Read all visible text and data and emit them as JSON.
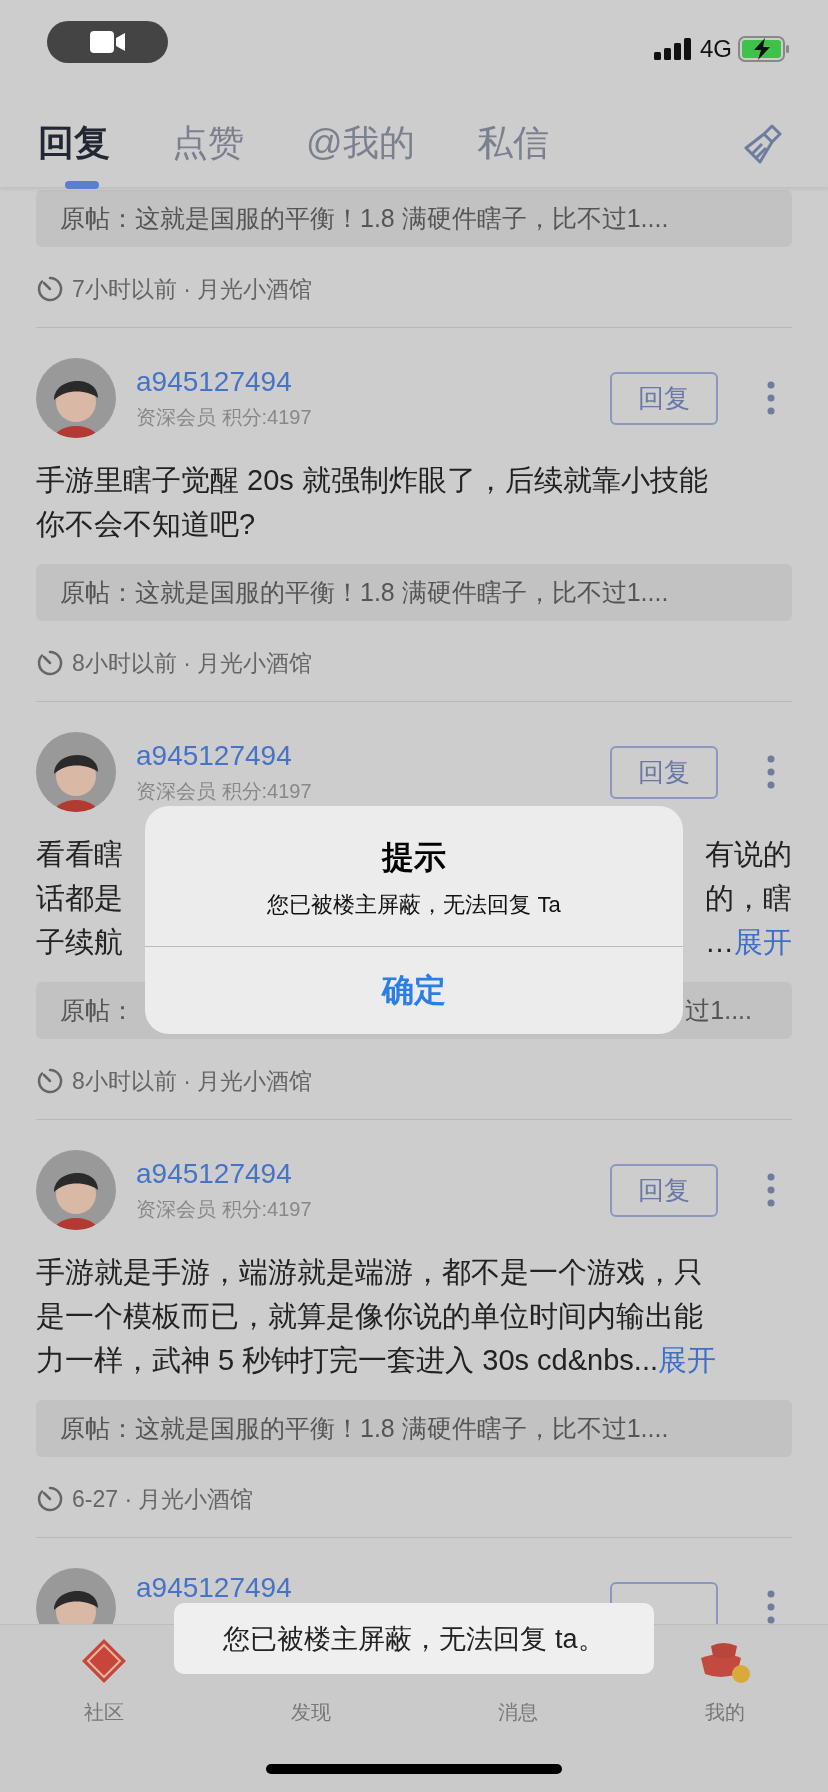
{
  "status_bar": {
    "network": "4G"
  },
  "tabs": [
    {
      "label": "回复",
      "selected": true
    },
    {
      "label": "点赞",
      "selected": false
    },
    {
      "label": "@我的",
      "selected": false
    },
    {
      "label": "私信",
      "selected": false
    }
  ],
  "posts": [
    {
      "kind": "partial",
      "original": "原帖：这就是国服的平衡！1.8 满硬件瞎子，比不过1....",
      "time": "7小时以前 · 月光小酒馆"
    },
    {
      "kind": "full",
      "author": "a945127494",
      "meta": "资深会员 积分:4197",
      "reply_button": "回复",
      "body": [
        "手游里瞎子觉醒 20s 就强制炸眼了，后续就靠小技能",
        "你不会不知道吧?"
      ],
      "original": "原帖：这就是国服的平衡！1.8 满硬件瞎子，比不过1....",
      "time": "8小时以前 · 月光小酒馆"
    },
    {
      "kind": "obscured",
      "author": "a945127494",
      "meta": "资深会员 积分:4197",
      "reply_button": "回复",
      "fragments": [
        {
          "left": "看看瞎",
          "right": "有说的"
        },
        {
          "left": "话都是",
          "right": "的，瞎"
        },
        {
          "left": "子续航",
          "right": "…",
          "expand": "展开"
        }
      ],
      "original_fragments": {
        "left": "原帖：",
        "right": "过1...."
      },
      "time": "8小时以前 · 月光小酒馆"
    },
    {
      "kind": "full",
      "author": "a945127494",
      "meta": "资深会员 积分:4197",
      "reply_button": "回复",
      "body": [
        "手游就是手游，端游就是端游，都不是一个游戏，只",
        "是一个模板而已，就算是像你说的单位时间内输出能",
        "力一样，武神 5 秒钟打完一套进入 30s cd&nbs..."
      ],
      "expand": "展开",
      "original": "原帖：这就是国服的平衡！1.8 满硬件瞎子，比不过1....",
      "time": "6-27 · 月光小酒馆"
    },
    {
      "kind": "header_only",
      "author": "a945127494"
    }
  ],
  "dialog": {
    "title": "提示",
    "message": "您已被楼主屏蔽，无法回复 Ta",
    "button": "确定"
  },
  "toast": "您已被楼主屏蔽，无法回复 ta。",
  "bottom_nav": [
    {
      "label": "社区"
    },
    {
      "label": "发现"
    },
    {
      "label": "消息"
    },
    {
      "label": "我的"
    }
  ]
}
